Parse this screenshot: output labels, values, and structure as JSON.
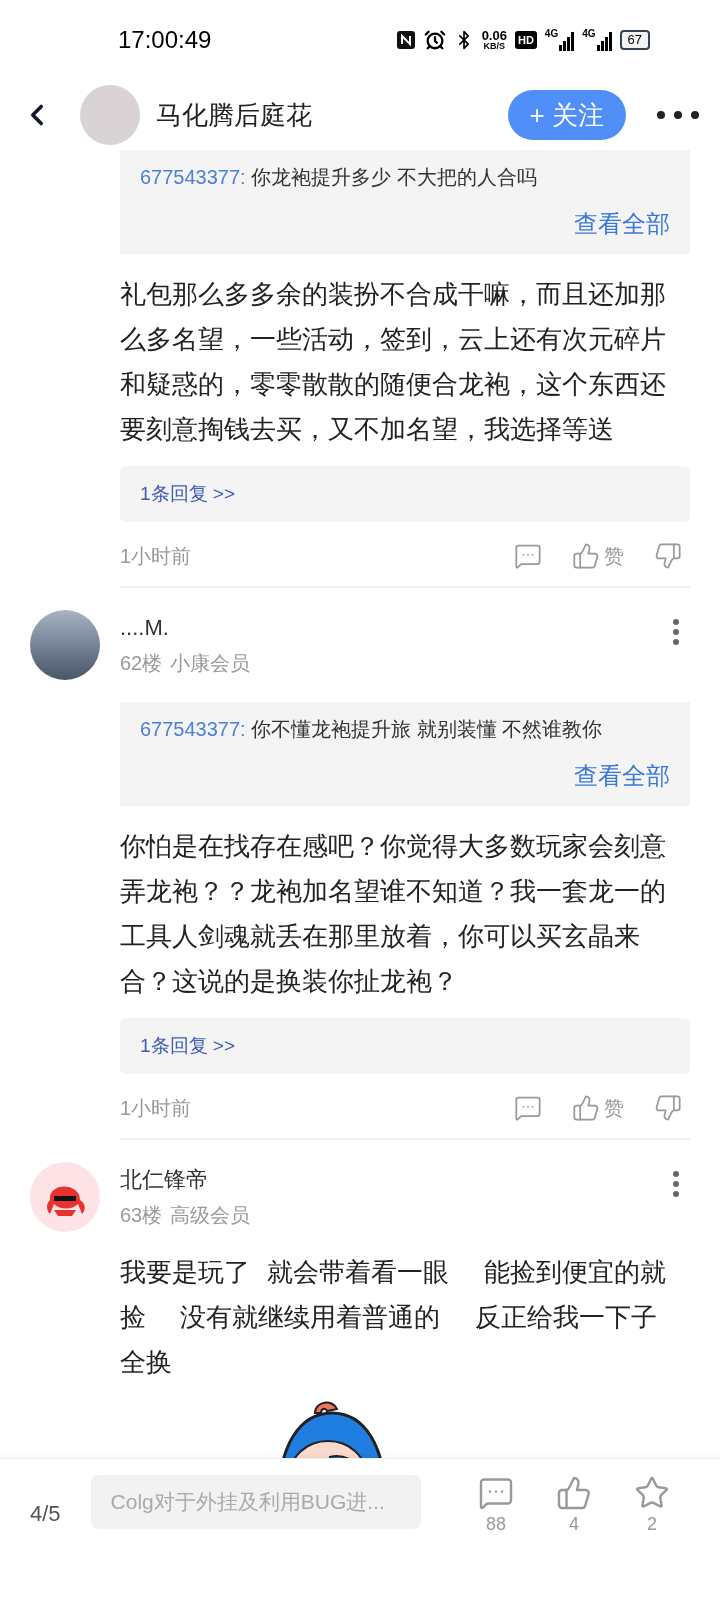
{
  "status_bar": {
    "time": "17:00:49",
    "net_speed": "0.06",
    "net_unit": "KB/S",
    "hd_label": "HD",
    "network_labels": [
      "4G",
      "4G"
    ],
    "battery": "67"
  },
  "header": {
    "author": "马化腾后庭花",
    "follow_button": "+ 关注"
  },
  "posts": [
    {
      "kind": "continued",
      "quote": {
        "user": "677543377:",
        "text": "你龙袍提升多少 不大把的人合吗",
        "view_all": "查看全部"
      },
      "body": "礼包那么多多余的装扮不合成干嘛，而且还加那么多名望，一些活动，签到，云上还有次元碎片和疑惑的，零零散散的随便合龙袍，这个东西还要刻意掏钱去买，又不加名望，我选择等送",
      "replies_link": "1条回复 >>",
      "time": "1小时前",
      "like_label": "赞"
    },
    {
      "kind": "full",
      "avatar": {
        "kind": "photo"
      },
      "author": "....M.",
      "floor": "62楼",
      "rank": "小康会员",
      "quote": {
        "user": "677543377:",
        "text": "你不懂龙袍提升旅 就别装懂 不然谁教你",
        "view_all": "查看全部"
      },
      "body": "你怕是在找存在感吧？你觉得大多数玩家会刻意弄龙袍？？龙袍加名望谁不知道？我一套龙一的工具人剑魂就丢在那里放着，你可以买玄晶来合？这说的是换装你扯龙袍？",
      "replies_link": "1条回复 >>",
      "time": "1小时前",
      "like_label": "赞"
    },
    {
      "kind": "partial",
      "avatar": {
        "kind": "cartoon"
      },
      "author": "北仁锋帝",
      "floor": "63楼",
      "rank": "高级会员",
      "body": "我要是玩了 就会带着看一眼  能捡到便宜的就捡  没有就继续用着普通的  反正给我一下子全换",
      "sticker": true
    }
  ],
  "bottom_bar": {
    "page": "4/5",
    "placeholder": "Colg对于外挂及利用BUG进...",
    "comments": "88",
    "likes": "4",
    "favorites": "2"
  }
}
